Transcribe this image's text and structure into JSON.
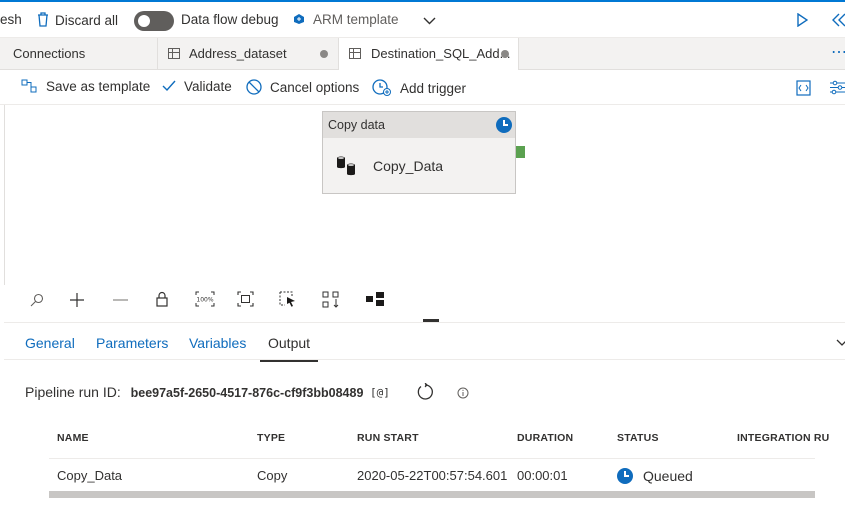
{
  "topbar": {
    "refresh_label": "esh",
    "discard_label": "Discard all",
    "dataflow_debug_label": "Data flow debug",
    "arm_label": "ARM template"
  },
  "tabs": [
    {
      "label": "Connections"
    },
    {
      "label": "Address_dataset"
    },
    {
      "label": "Destination_SQL_Add..."
    }
  ],
  "toolbar": {
    "save_template_label": "Save as template",
    "validate_label": "Validate",
    "cancel_options_label": "Cancel options",
    "add_trigger_label": "Add trigger"
  },
  "activity": {
    "type_label": "Copy data",
    "name": "Copy_Data"
  },
  "bottom_tabs": {
    "general": "General",
    "parameters": "Parameters",
    "variables": "Variables",
    "output": "Output"
  },
  "output": {
    "run_id_label": "Pipeline run ID:",
    "run_id": "bee97a5f-2650-4517-876c-cf9f3bb08489",
    "columns": {
      "name": "NAME",
      "type": "TYPE",
      "run_start": "RUN START",
      "duration": "DURATION",
      "status": "STATUS",
      "integration": "INTEGRATION RU"
    },
    "rows": [
      {
        "name": "Copy_Data",
        "type": "Copy",
        "run_start": "2020-05-22T00:57:54.601",
        "duration": "00:00:01",
        "status": "Queued"
      }
    ]
  },
  "colors": {
    "accent": "#0f6cbd",
    "success_connector": "#5ba150"
  }
}
